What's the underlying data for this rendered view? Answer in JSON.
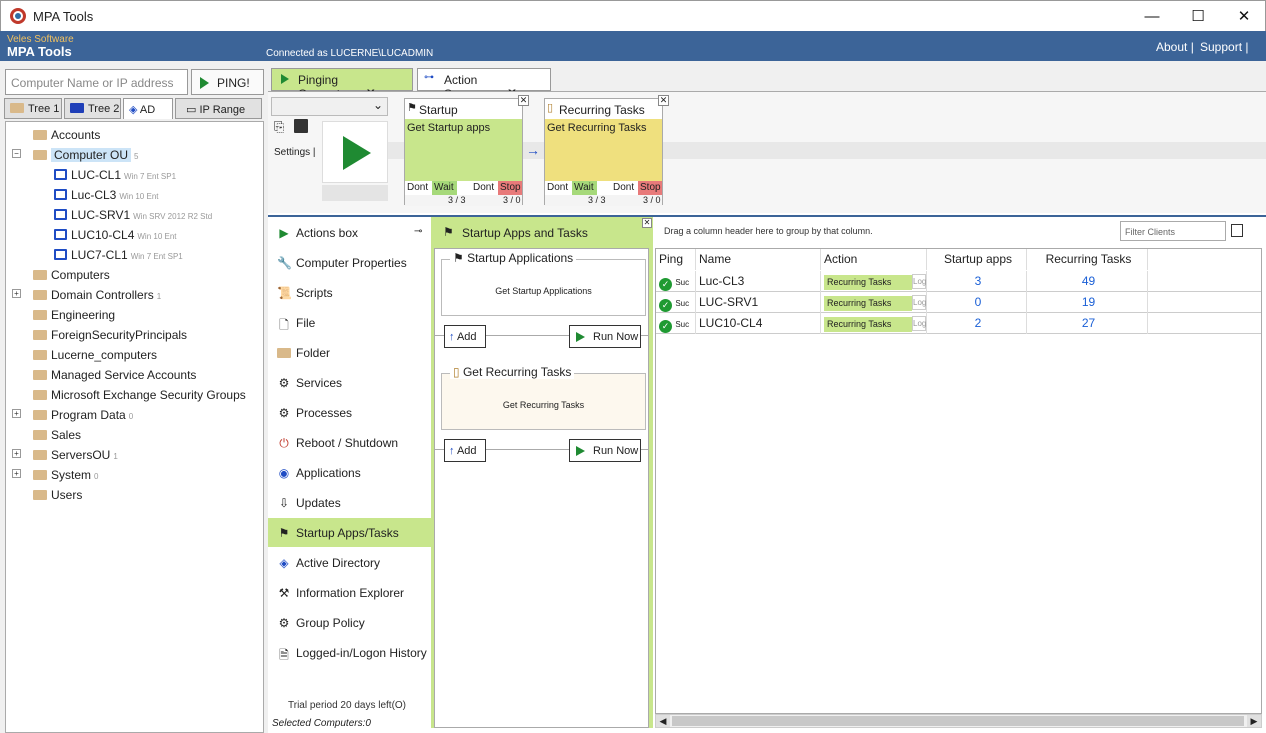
{
  "window": {
    "title": "MPA Tools",
    "min": "—",
    "max": "☐",
    "close": "✕"
  },
  "header": {
    "vendor": "Veles Software",
    "brand": "MPA Tools",
    "connected": "Connected as LUCERNE\\LUCADMIN",
    "about": "About |",
    "support": "Support |"
  },
  "search": {
    "placeholder": "Computer Name or IP address",
    "ping": "PING!"
  },
  "left_tabs": [
    "Tree 1",
    "Tree 2",
    "AD",
    "IP Range"
  ],
  "tree": [
    {
      "label": "Accounts",
      "sub": ""
    },
    {
      "label": "Computer OU",
      "sub": "5"
    },
    {
      "label": "LUC-CL1",
      "sub": "Win 7 Ent SP1"
    },
    {
      "label": "Luc-CL3",
      "sub": "Win 10 Ent"
    },
    {
      "label": "LUC-SRV1",
      "sub": "Win SRV 2012 R2 Std"
    },
    {
      "label": "LUC10-CL4",
      "sub": "Win 10 Ent"
    },
    {
      "label": "LUC7-CL1",
      "sub": "Win 7 Ent SP1"
    },
    {
      "label": "Computers",
      "sub": ""
    },
    {
      "label": "Domain Controllers",
      "sub": "1"
    },
    {
      "label": "Engineering",
      "sub": ""
    },
    {
      "label": "ForeignSecurityPrincipals",
      "sub": ""
    },
    {
      "label": "Lucerne_computers",
      "sub": ""
    },
    {
      "label": "Managed Service Accounts",
      "sub": ""
    },
    {
      "label": "Microsoft Exchange Security Groups",
      "sub": ""
    },
    {
      "label": "Program Data",
      "sub": "0"
    },
    {
      "label": "Sales",
      "sub": ""
    },
    {
      "label": "ServersOU",
      "sub": "1"
    },
    {
      "label": "System",
      "sub": "0"
    },
    {
      "label": "Users",
      "sub": ""
    }
  ],
  "top_tabs": [
    {
      "label": "Pinging Computers",
      "close": "X"
    },
    {
      "label": "Action Sequence",
      "close": "X"
    }
  ],
  "sequence": {
    "settings": "Settings |",
    "cards": [
      {
        "title": "Startup Applications",
        "body": "Get Startup apps",
        "dont1": "Dont",
        "wait": "Wait",
        "dont2": "Dont",
        "stop": "Stop",
        "count1": "3 / 3",
        "count2": "3 / 0",
        "color": "#c8e68c"
      },
      {
        "title": "Recurring Tasks",
        "body": "Get Recurring Tasks",
        "dont1": "Dont",
        "wait": "Wait",
        "dont2": "Dont",
        "stop": "Stop",
        "count1": "3 / 3",
        "count2": "3 / 0",
        "color": "#efe07e"
      }
    ]
  },
  "actions": {
    "items": [
      "Actions box",
      "Computer Properties",
      "Scripts",
      "File",
      "Folder",
      "Services",
      "Processes",
      "Reboot / Shutdown",
      "Applications",
      "Updates",
      "Startup Apps/Tasks",
      "Active Directory",
      "Information Explorer",
      "Group Policy",
      "Logged-in/Logon History"
    ],
    "trial": "Trial period 20 days left(O)",
    "selected": "Selected Computers:0"
  },
  "middle": {
    "title": "Startup Apps and Tasks",
    "groups": [
      {
        "title": "Startup Applications",
        "text": "Get Startup Applications",
        "add": "Add",
        "run": "Run Now"
      },
      {
        "title": "Get Recurring Tasks",
        "text": "Get Recurring Tasks",
        "add": "Add",
        "run": "Run Now"
      }
    ]
  },
  "grid": {
    "hint": "Drag a column header here to group by that column.",
    "filter_placeholder": "Filter Clients",
    "columns": [
      "Ping",
      "Name",
      "Action",
      "Startup apps",
      "Recurring Tasks"
    ],
    "rows": [
      {
        "ping": "Suc",
        "name": "Luc-CL3",
        "action": "Recurring Tasks",
        "log": "Log",
        "startup": "3",
        "recurring": "49"
      },
      {
        "ping": "Suc",
        "name": "LUC-SRV1",
        "action": "Recurring Tasks",
        "log": "Log",
        "startup": "0",
        "recurring": "19"
      },
      {
        "ping": "Suc",
        "name": "LUC10-CL4",
        "action": "Recurring Tasks",
        "log": "Log",
        "startup": "2",
        "recurring": "27"
      }
    ]
  }
}
